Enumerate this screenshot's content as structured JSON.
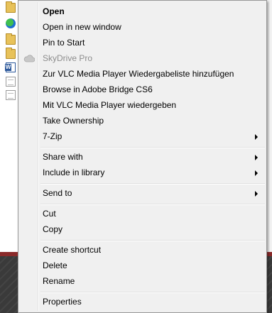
{
  "menu": {
    "items": [
      {
        "label": "Open",
        "bold": true
      },
      {
        "label": "Open in new window"
      },
      {
        "label": "Pin to Start"
      },
      {
        "label": "SkyDrive Pro",
        "disabled": true,
        "icon": "cloud-icon"
      },
      {
        "label": "Zur VLC Media Player Wiedergabeliste hinzufügen"
      },
      {
        "label": "Browse in Adobe Bridge CS6"
      },
      {
        "label": "Mit VLC Media Player wiedergeben"
      },
      {
        "label": "Take Ownership"
      },
      {
        "label": "7-Zip",
        "submenu": true
      },
      {
        "label": "Share with",
        "submenu": true
      },
      {
        "label": "Include in library",
        "submenu": true
      },
      {
        "label": "Send to",
        "submenu": true
      },
      {
        "label": "Cut"
      },
      {
        "label": "Copy"
      },
      {
        "label": "Create shortcut"
      },
      {
        "label": "Delete"
      },
      {
        "label": "Rename"
      },
      {
        "label": "Properties"
      }
    ]
  },
  "background": {
    "file_icons": [
      "folder-icon",
      "sync-folder-icon",
      "folder-icon",
      "folder-icon",
      "word-document-icon",
      "text-document-icon",
      "text-document-icon"
    ]
  },
  "colors": {
    "menu_background": "#f0f0f0",
    "disabled_text": "#8d8d8d"
  }
}
